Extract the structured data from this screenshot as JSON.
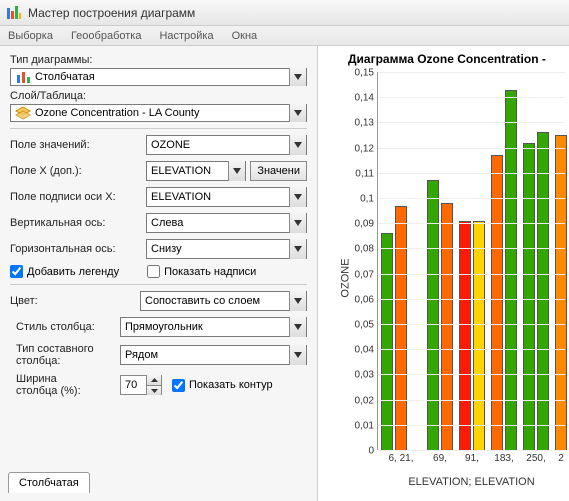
{
  "window": {
    "title": "Мастер построения диаграмм"
  },
  "menubar": {
    "items": [
      "Выборка",
      "Геообработка",
      "Настройка",
      "Окна"
    ]
  },
  "chart_data": {
    "type": "bar",
    "title": "Диаграмма  Ozone Concentration -",
    "xlabel": "ELEVATION; ELEVATION",
    "ylabel": "OZONE",
    "ylim": [
      0,
      0.15
    ],
    "yticks": [
      0,
      0.01,
      0.02,
      0.03,
      0.04,
      0.05,
      0.06,
      0.07,
      0.08,
      0.09,
      0.1,
      0.11,
      0.12,
      0.13,
      0.14,
      0.15
    ],
    "categories": [
      "6, 21,",
      "69,",
      "91,",
      "183,",
      "250,",
      "2"
    ],
    "series": [
      {
        "name": "OZONE",
        "values": [
          0.086,
          0.097,
          null,
          0.107,
          0.098,
          0.091,
          0.091,
          0.117,
          0.143,
          0.122,
          0.126,
          0.125
        ],
        "colors": [
          "#34a600",
          "#ff6a00",
          "",
          "#34a600",
          "#ff6a00",
          "#ff1a00",
          "#ffd400",
          "#ff6a00",
          "#34a600",
          "#34a600",
          "#34a600",
          "#ff8a00"
        ]
      }
    ]
  },
  "form": {
    "chart_type_label": "Тип диаграммы:",
    "chart_type_value": "Столбчатая",
    "layer_label": "Слой/Таблица:",
    "layer_value": "Ozone Concentration - LA County",
    "value_field_label": "Поле значений:",
    "value_field_value": "OZONE",
    "x_field_label": "Поле X (доп.):",
    "x_field_value": "ELEVATION",
    "x_field_btn": "Значени",
    "x_axis_label_label": "Поле подписи оси X:",
    "x_axis_label_value": "ELEVATION",
    "vaxis_label": "Вертикальная ось:",
    "vaxis_value": "Слева",
    "haxis_label": "Горизонтальная ось:",
    "haxis_value": "Снизу",
    "legend_label": "Добавить легенду",
    "labels_label": "Показать надписи",
    "color_label": "Цвет:",
    "color_value": "Сопоставить со слоем",
    "bar_style_label": "Стиль столбца:",
    "bar_style_value": "Прямоугольник",
    "multi_label1": "Тип составного",
    "multi_label2": "столбца:",
    "multi_value": "Рядом",
    "width_label1": "Ширина",
    "width_label2": "столбца (%):",
    "width_value": "70",
    "outline_label": "Показать контур",
    "tab_label": "Столбчатая"
  }
}
